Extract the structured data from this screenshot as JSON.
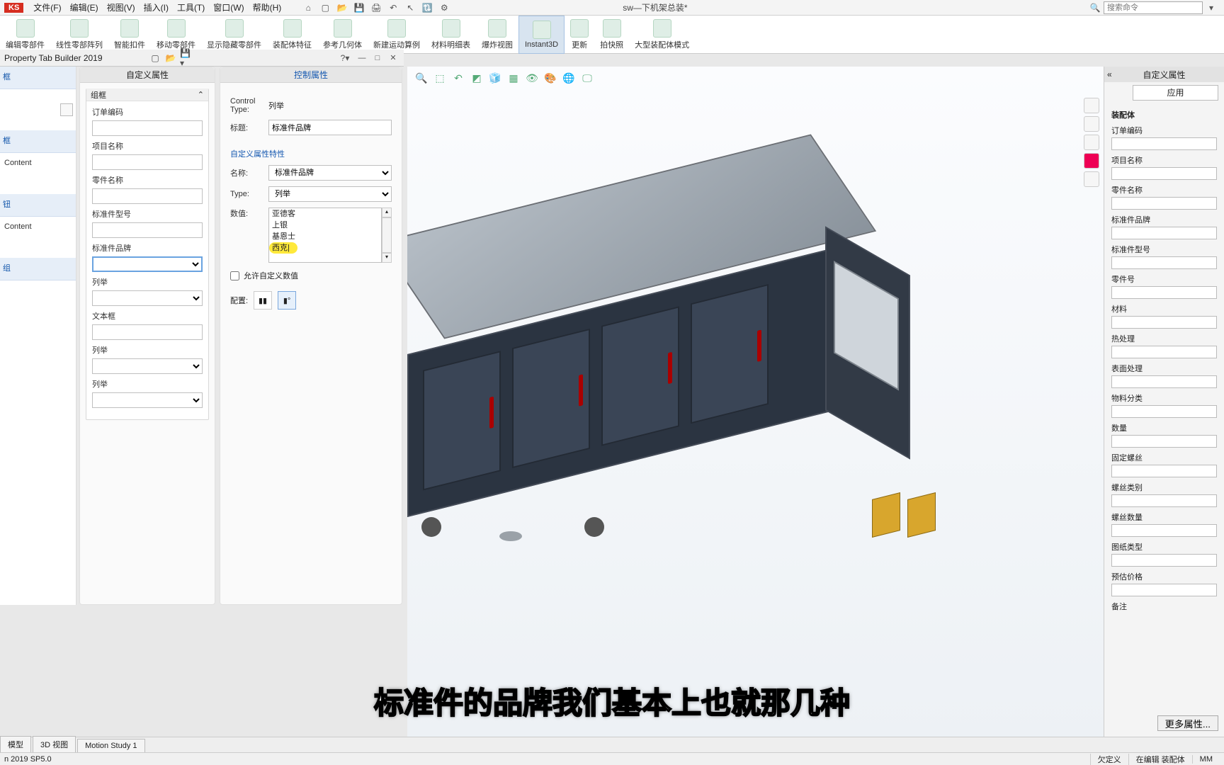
{
  "logo": "KS",
  "menus": [
    "文件(F)",
    "编辑(E)",
    "视图(V)",
    "插入(I)",
    "工具(T)",
    "窗口(W)",
    "帮助(H)"
  ],
  "doc_title": "sw—下机架总装*",
  "search_placeholder": "搜索命令",
  "ribbon": [
    {
      "label": "编辑零部件"
    },
    {
      "label": "线性零部阵列"
    },
    {
      "label": "智能扣件"
    },
    {
      "label": "移动零部件"
    },
    {
      "label": "显示隐藏零部件"
    },
    {
      "label": "装配体特征"
    },
    {
      "label": "参考几何体"
    },
    {
      "label": "新建运动算例"
    },
    {
      "label": "材料明细表"
    },
    {
      "label": "爆炸视图"
    },
    {
      "label": "Instant3D"
    },
    {
      "label": "更新"
    },
    {
      "label": "拍快照"
    },
    {
      "label": "大型装配体模式"
    }
  ],
  "ptb": {
    "title": "Property Tab Builder 2019"
  },
  "palette": [
    {
      "type": "sect",
      "label": "框"
    },
    {
      "type": "sect",
      "label": "框"
    },
    {
      "type": "item",
      "label": "Content"
    },
    {
      "type": "sect",
      "label": "钮"
    },
    {
      "type": "item",
      "label": "Content"
    },
    {
      "type": "sect",
      "label": "组"
    }
  ],
  "mid": {
    "header": "自定义属性",
    "group_title": "组框",
    "fields": [
      {
        "label": "订单编码",
        "kind": "text"
      },
      {
        "label": "项目名称",
        "kind": "text"
      },
      {
        "label": "零件名称",
        "kind": "text"
      },
      {
        "label": "标准件型号",
        "kind": "text"
      },
      {
        "label": "标准件品牌",
        "kind": "select",
        "selected": true
      },
      {
        "label": "列举",
        "kind": "select"
      },
      {
        "label": "文本框",
        "kind": "text"
      },
      {
        "label": "列举",
        "kind": "select"
      },
      {
        "label": "列举",
        "kind": "select"
      }
    ]
  },
  "ctrl": {
    "header": "控制属性",
    "control_type_k": "Control Type:",
    "control_type_v": "列举",
    "caption_k": "标题:",
    "caption_v": "标准件品牌",
    "sect": "自定义属性特性",
    "name_k": "名称:",
    "name_v": "标准件品牌",
    "type_k": "Type:",
    "type_v": "列举",
    "values_k": "数值:",
    "values": [
      "亚德客",
      "上银",
      "基恩士",
      "西克|"
    ],
    "allow_custom": "允许自定义数值",
    "config_k": "配置:"
  },
  "taskpane": {
    "header": "自定义属性",
    "tab": "应用",
    "section": "装配体",
    "fields": [
      "订单编码",
      "项目名称",
      "零件名称",
      "标准件品牌",
      "标准件型号",
      "零件号",
      "材料",
      "热处理",
      "表面处理",
      "物料分类",
      "数量",
      "固定螺丝",
      "螺丝类别",
      "螺丝数量",
      "图纸类型",
      "预估价格",
      "备注"
    ],
    "more": "更多属性..."
  },
  "bottom_tabs": [
    "模型",
    "3D 视图",
    "Motion Study 1"
  ],
  "status": {
    "left": "n 2019 SP5.0",
    "a": "欠定义",
    "b": "在编辑 装配体",
    "c": "MM"
  },
  "subtitle": "标准件的品牌我们基本上也就那几种"
}
